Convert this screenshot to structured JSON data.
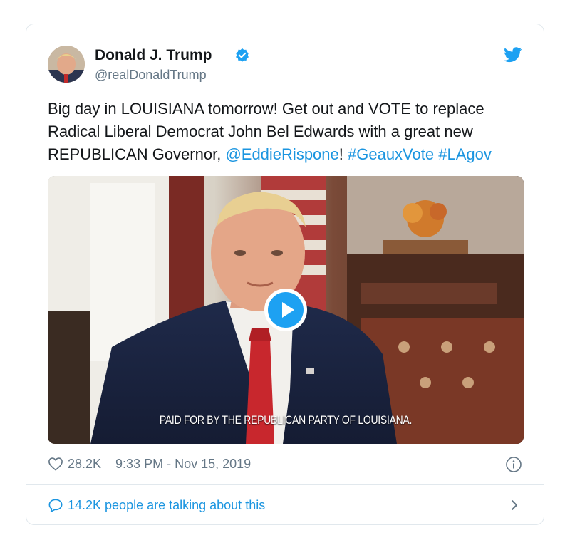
{
  "author": {
    "name": "Donald J. Trump",
    "handle": "@realDonaldTrump",
    "verified_icon": "verified-badge-icon",
    "brand_icon": "twitter-bird-icon"
  },
  "tweet": {
    "text_part1": "Big day in LOUISIANA tomorrow! Get out and VOTE to replace Radical Liberal Democrat John Bel Edwards with a great new REPUBLICAN Governor, ",
    "mention": "@EddieRispone",
    "text_part2": "! ",
    "hashtag1": "#GeauxVote",
    "space": " ",
    "hashtag2": "#LAgov"
  },
  "video": {
    "caption": "PAID FOR BY THE REPUBLICAN PARTY OF LOUISIANA.",
    "play_icon": "play-icon"
  },
  "footer": {
    "likes": "28.2K",
    "timestamp": "9:33 PM - Nov 15, 2019",
    "talking": "14.2K people are talking about this"
  },
  "colors": {
    "accent": "#1da1f2",
    "link": "#1b95e0",
    "muted": "#657786",
    "border": "#e1e8ed"
  }
}
